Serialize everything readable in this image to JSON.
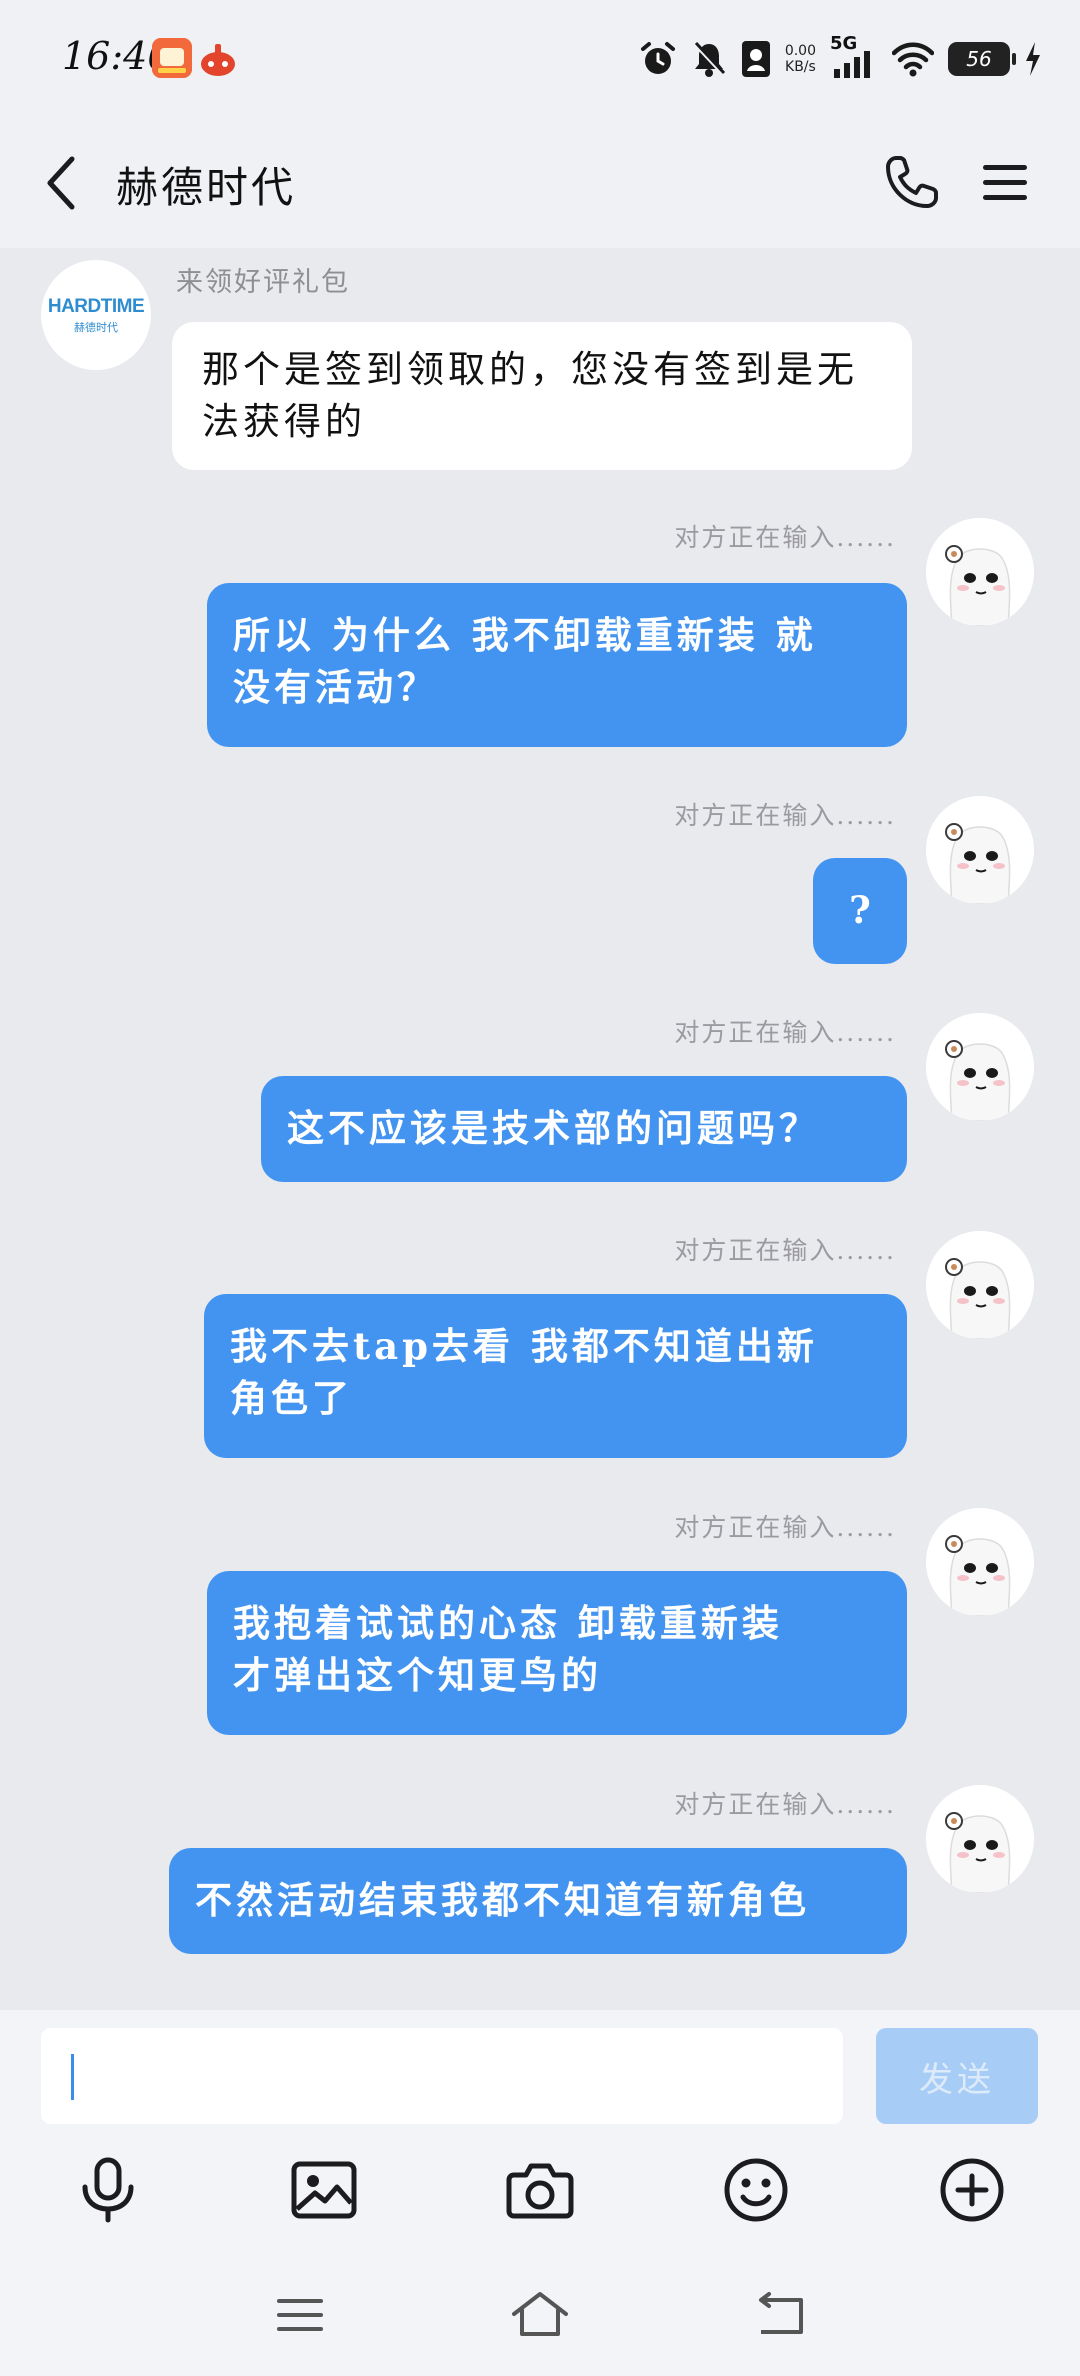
{
  "status_bar": {
    "time": "16:46",
    "net_speed_value": "0.00",
    "net_speed_unit": "KB/s",
    "signal_label": "5G",
    "battery_level": "56"
  },
  "header": {
    "title": "赫德时代"
  },
  "incoming": {
    "avatar_brand": "HARDTIME",
    "avatar_brand_sub": "赫德时代",
    "sender_name": "来领好评礼包",
    "message": "那个是签到领取的，您没有签到是无法获得的"
  },
  "typing_indicator": "对方正在输入......",
  "outgoing": [
    {
      "line1": "所以 为什么 我不卸载重新装 就",
      "line2": "没有活动？"
    },
    {
      "line1": "?",
      "line2": ""
    },
    {
      "line1": "这不应该是技术部的问题吗？",
      "line2": ""
    },
    {
      "line1": "我不去tap去看  我都不知道出新",
      "line2": "角色了"
    },
    {
      "line1": "我抱着试试的心态 卸载重新装",
      "line2": "才弹出这个知更鸟的"
    },
    {
      "line1": "不然活动结束我都不知道有新角色",
      "line2": ""
    }
  ],
  "input": {
    "value": "",
    "send_label": "发送"
  },
  "icons": {
    "back": "back-arrow-icon",
    "call": "phone-icon",
    "menu": "menu-icon",
    "mic": "microphone-icon",
    "image": "image-icon",
    "camera": "camera-icon",
    "emoji": "emoji-icon",
    "plus": "plus-icon"
  },
  "colors": {
    "outgoing_bubble": "#4394f0",
    "incoming_bubble": "#ffffff",
    "send_button_disabled": "#a7cdf6",
    "chat_background": "#e9eaee"
  }
}
